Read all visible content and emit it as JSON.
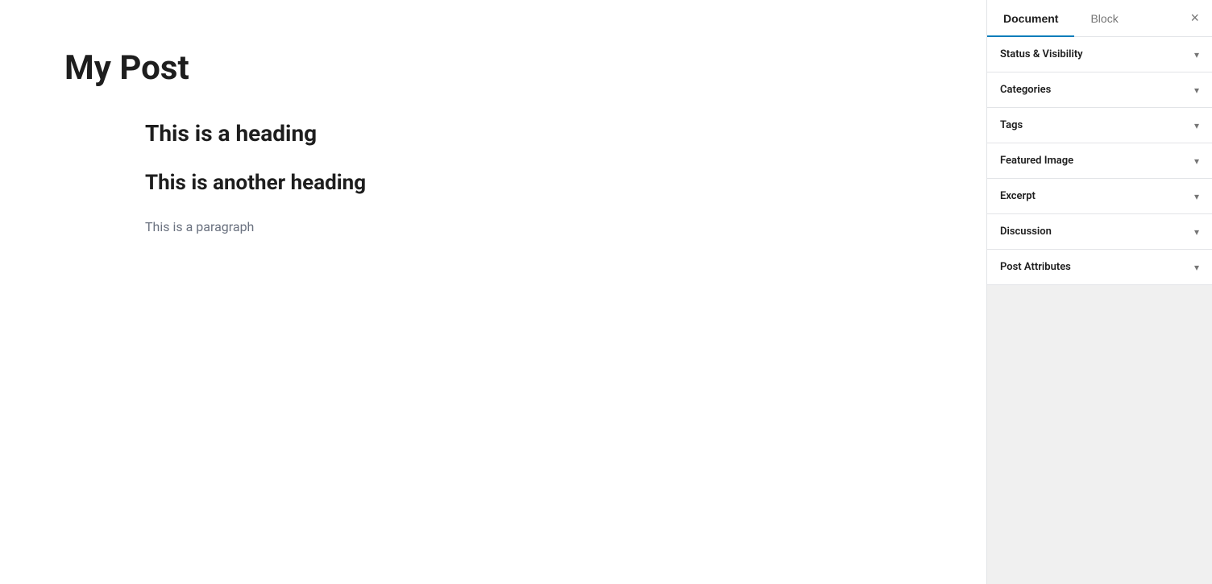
{
  "editor": {
    "post_title": "My Post",
    "heading1": "This is a heading",
    "heading2": "This is another heading",
    "paragraph": "This is a paragraph"
  },
  "sidebar": {
    "tab_document": "Document",
    "tab_block": "Block",
    "close_label": "×",
    "panels": [
      {
        "id": "status-visibility",
        "label": "Status & Visibility"
      },
      {
        "id": "categories",
        "label": "Categories"
      },
      {
        "id": "tags",
        "label": "Tags"
      },
      {
        "id": "featured-image",
        "label": "Featured Image"
      },
      {
        "id": "excerpt",
        "label": "Excerpt"
      },
      {
        "id": "discussion",
        "label": "Discussion"
      },
      {
        "id": "post-attributes",
        "label": "Post Attributes"
      }
    ]
  }
}
